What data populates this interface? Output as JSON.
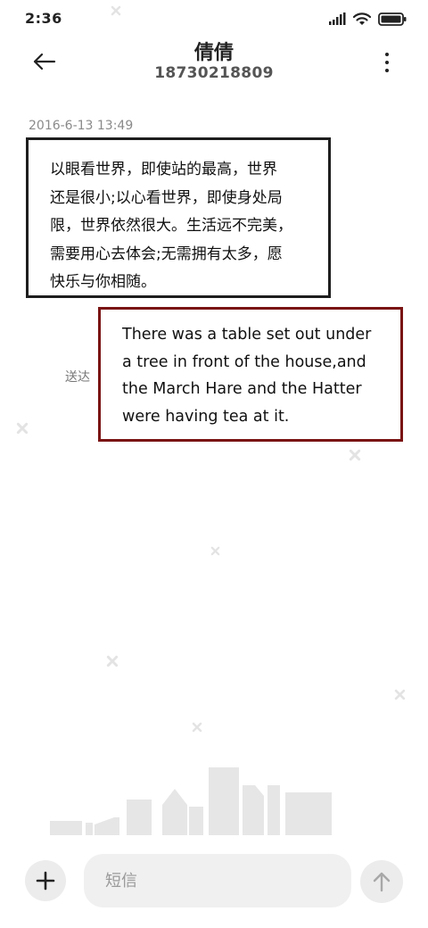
{
  "status_bar": {
    "time": "2:36",
    "icons": [
      "signal-icon",
      "wifi-icon",
      "battery-icon"
    ]
  },
  "header": {
    "back_icon": "arrow-left-icon",
    "contact_name": "倩倩",
    "contact_number": "18730218809",
    "more_icon": "more-vertical-icon"
  },
  "conversation": {
    "timestamp": "2016-6-13 13:49",
    "incoming_message": {
      "lines": [
        "以眼看世界，即使站的最高，世界",
        "还是很小;以心看世界，即使身处局",
        "限，世界依然很大。生活远不完美，",
        "需要用心去体会;无需拥有太多，愿",
        "快乐与你相随。"
      ],
      "border_color": "#1e1e1e"
    },
    "outgoing_message": {
      "lines": [
        "There was a table set out under",
        "a tree in front of the house,and",
        "the March Hare and the Hatter",
        "were having tea at it."
      ],
      "border_color": "#7a1414"
    },
    "delivery_status": "送达"
  },
  "composer": {
    "attach_icon": "plus-icon",
    "input_placeholder": "短信",
    "input_value": "",
    "send_icon": "arrow-up-icon"
  },
  "decorations": {
    "background_icons": [
      "moon-icon",
      "star-cross-icon",
      "city-skyline-icon"
    ]
  }
}
